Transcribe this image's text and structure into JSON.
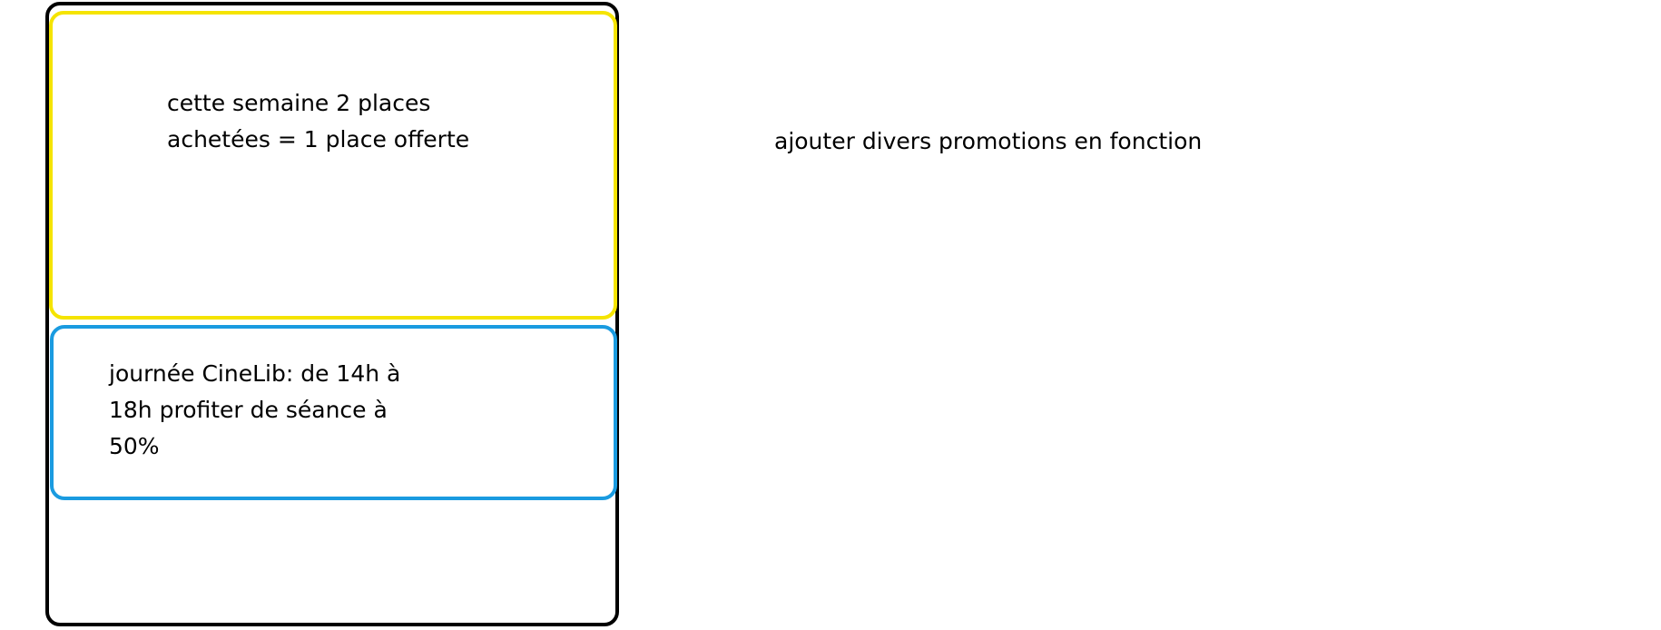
{
  "promotions": [
    {
      "text": "cette semaine 2 places\nachetées = 1 place offerte",
      "border_color": "#f5e400"
    },
    {
      "text": "journée CineLib: de 14h à\n18h profiter de séance à\n50%",
      "border_color": "#1a9be0"
    }
  ],
  "note": "ajouter divers promotions en fonction",
  "frame_color": "#000000"
}
